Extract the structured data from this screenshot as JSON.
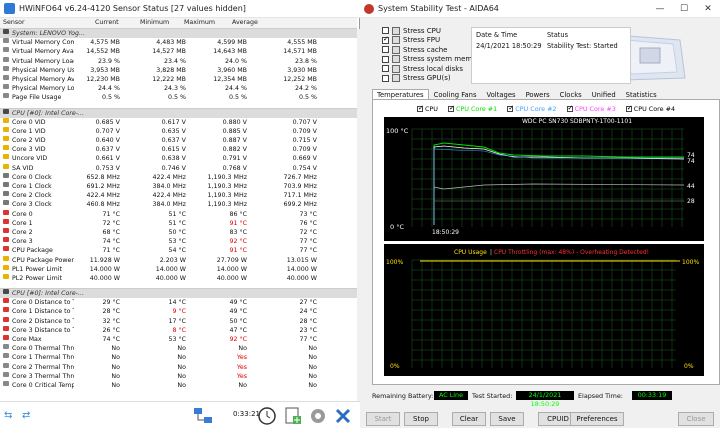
{
  "hwinfo": {
    "title": "HWiNFO64 v6.24-4120 Sensor Status [27 values hidden]",
    "columns": [
      "Sensor",
      "Current",
      "Minimum",
      "Maximum",
      "Average"
    ],
    "groups": [
      {
        "title": "System: LENOVO Yog...",
        "rows": [
          [
            "Virtual Memory Com...",
            "4,575 MB",
            "4,483 MB",
            "4,599 MB",
            "4,555 MB"
          ],
          [
            "Virtual Memory Avail...",
            "14,552 MB",
            "14,527 MB",
            "14,643 MB",
            "14,571 MB"
          ],
          [
            "Virtual Memory Load",
            "23.9 %",
            "23.4 %",
            "24.0 %",
            "23.8 %"
          ],
          [
            "Physical Memory Used",
            "3,953 MB",
            "3,828 MB",
            "3,960 MB",
            "3,930 MB"
          ],
          [
            "Physical Memory Avai...",
            "12,230 MB",
            "12,222 MB",
            "12,354 MB",
            "12,252 MB"
          ],
          [
            "Physical Memory Load",
            "24.4 %",
            "24.3 %",
            "24.4 %",
            "24.2 %"
          ],
          [
            "Page File Usage",
            "0.5 %",
            "0.5 %",
            "0.5 %",
            "0.5 %"
          ]
        ]
      },
      {
        "title": "CPU [#0]: Intel Core-...",
        "rows": [
          [
            "Core 0 VID",
            "0.685 V",
            "0.617 V",
            "0.880 V",
            "0.707 V"
          ],
          [
            "Core 1 VID",
            "0.707 V",
            "0.635 V",
            "0.885 V",
            "0.709 V"
          ],
          [
            "Core 2 VID",
            "0.640 V",
            "0.637 V",
            "0.887 V",
            "0.715 V"
          ],
          [
            "Core 3 VID",
            "0.637 V",
            "0.615 V",
            "0.882 V",
            "0.709 V"
          ],
          [
            "Uncore VID",
            "0.661 V",
            "0.638 V",
            "0.791 V",
            "0.669 V"
          ],
          [
            "SA VID",
            "0.753 V",
            "0.746 V",
            "0.768 V",
            "0.754 V"
          ],
          [
            "Core 0 Clock",
            "652.8 MHz",
            "422.4 MHz",
            "1,190.3 MHz",
            "726.7 MHz"
          ],
          [
            "Core 1 Clock",
            "691.2 MHz",
            "384.0 MHz",
            "1,190.3 MHz",
            "703.9 MHz"
          ],
          [
            "Core 2 Clock",
            "422.4 MHz",
            "422.4 MHz",
            "1,190.3 MHz",
            "717.1 MHz"
          ],
          [
            "Core 3 Clock",
            "460.8 MHz",
            "384.0 MHz",
            "1,190.3 MHz",
            "699.2 MHz"
          ],
          [
            "Core 0",
            "71 °C",
            "51 °C",
            "86 °C",
            "73 °C"
          ],
          [
            "Core 1",
            "72 °C",
            "51 °C",
            "91 °C",
            "76 °C"
          ],
          [
            "Core 2",
            "68 °C",
            "50 °C",
            "83 °C",
            "72 °C"
          ],
          [
            "Core 3",
            "74 °C",
            "53 °C",
            "92 °C",
            "77 °C"
          ],
          [
            "CPU Package",
            "71 °C",
            "54 °C",
            "91 °C",
            "77 °C"
          ],
          [
            "CPU Package Power",
            "11.928 W",
            "2.203 W",
            "27.709 W",
            "13.015 W"
          ],
          [
            "PL1 Power Limit",
            "14.000 W",
            "14.000 W",
            "14.000 W",
            "14.000 W"
          ],
          [
            "PL2 Power Limit",
            "40.000 W",
            "40.000 W",
            "40.000 W",
            "40.000 W"
          ]
        ]
      },
      {
        "title": "CPU [#0]: Intel Core-...",
        "rows": [
          [
            "Core 0 Distance to Tj...",
            "29 °C",
            "14 °C",
            "49 °C",
            "27 °C"
          ],
          [
            "Core 1 Distance to Tj...",
            "28 °C",
            "9 °C",
            "49 °C",
            "24 °C"
          ],
          [
            "Core 2 Distance to Tj...",
            "32 °C",
            "17 °C",
            "50 °C",
            "28 °C"
          ],
          [
            "Core 3 Distance to Tj...",
            "26 °C",
            "8 °C",
            "47 °C",
            "23 °C"
          ],
          [
            "Core Max",
            "74 °C",
            "53 °C",
            "92 °C",
            "77 °C"
          ],
          [
            "Core 0 Thermal Throt...",
            "No",
            "No",
            "No",
            "No"
          ],
          [
            "Core 1 Thermal Throt...",
            "No",
            "No",
            "Yes",
            "No"
          ],
          [
            "Core 2 Thermal Throt...",
            "No",
            "No",
            "Yes",
            "No"
          ],
          [
            "Core 3 Thermal Throt...",
            "No",
            "No",
            "Yes",
            "No"
          ],
          [
            "Core 0 Critical Tempe...",
            "No",
            "No",
            "No",
            "No"
          ]
        ]
      }
    ],
    "timer": "0:33:21"
  },
  "aida": {
    "title": "System Stability Test - AIDA64",
    "stress": [
      {
        "label": "Stress CPU",
        "checked": false
      },
      {
        "label": "Stress FPU",
        "checked": true
      },
      {
        "label": "Stress cache",
        "checked": false
      },
      {
        "label": "Stress system mem",
        "checked": false
      },
      {
        "label": "Stress local disks",
        "checked": false
      },
      {
        "label": "Stress GPU(s)",
        "checked": false
      }
    ],
    "info": {
      "h_date": "Date & Time",
      "h_status": "Status",
      "date": "24/1/2021 18:50:29",
      "status": "Stability Test: Started"
    },
    "tabs": [
      "Temperatures",
      "Cooling Fans",
      "Voltages",
      "Powers",
      "Clocks",
      "Unified",
      "Statistics"
    ],
    "legend": [
      {
        "label": "CPU",
        "color": "#ffffff"
      },
      {
        "label": "CPU Core #1",
        "color": "#00e000"
      },
      {
        "label": "CPU Core #2",
        "color": "#40a0ff"
      },
      {
        "label": "CPU Core #3",
        "color": "#ff40ff"
      },
      {
        "label": "CPU Core #4",
        "color": "#ffffff"
      }
    ],
    "legend2": "WDC PC SN730 SDBPNTY-1T00-1101",
    "temp_chart": {
      "ymax_label": "100 °C",
      "ymin_label": "0 °C",
      "time_label": "18:50:29",
      "values": [
        "74",
        "74",
        "44",
        "28"
      ]
    },
    "usage_chart": {
      "title1": "CPU Usage",
      "sep": "|",
      "title2": "CPU Throttling (max: 48%) - Overheating Detected!",
      "ytop": "100%",
      "ybot": "0%",
      "ytop_r": "100%",
      "ybot_r": "0%"
    },
    "status": {
      "battery_label": "Remaining Battery:",
      "battery": "AC Line",
      "started_label": "Test Started:",
      "started": "24/1/2021 18:50:29",
      "elapsed_label": "Elapsed Time:",
      "elapsed": "00:33:19"
    },
    "buttons": [
      "Start",
      "Stop",
      "Clear",
      "Save",
      "CPUID",
      "Preferences",
      "Close"
    ]
  }
}
